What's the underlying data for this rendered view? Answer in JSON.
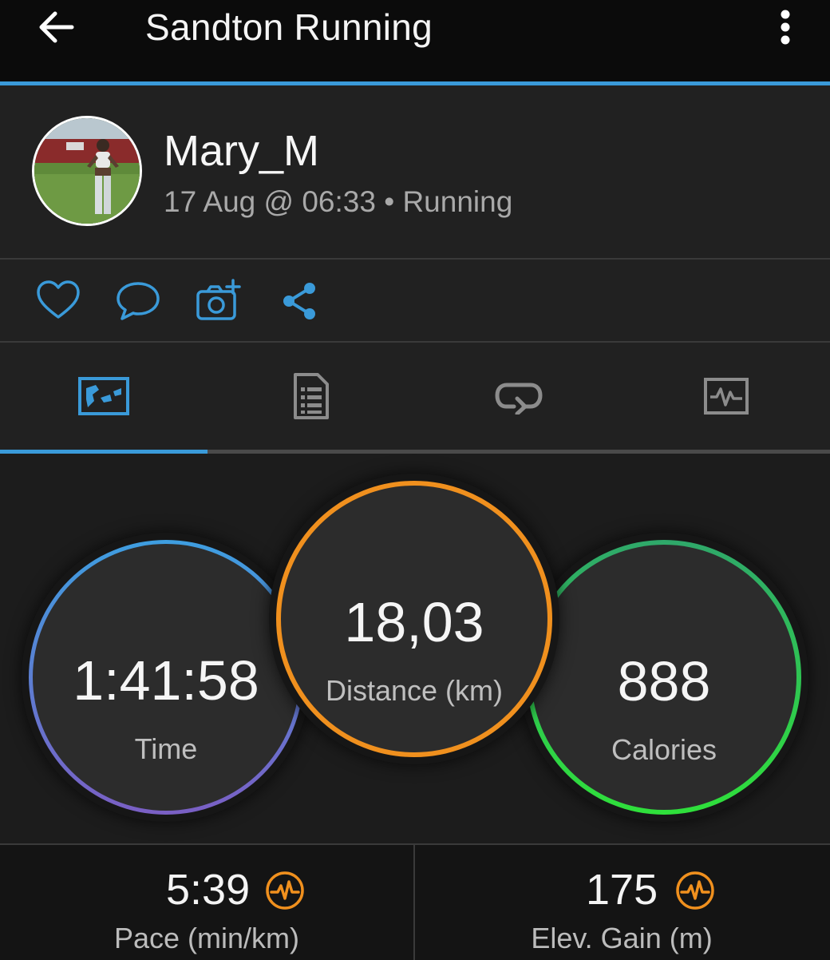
{
  "header": {
    "title": "Sandton Running",
    "back_icon": "arrow-left-icon",
    "menu_icon": "more-vertical-icon"
  },
  "profile": {
    "username": "Mary_M",
    "meta": "17 Aug @ 06:33 • Running"
  },
  "actions": [
    {
      "icon": "heart-icon"
    },
    {
      "icon": "comment-icon"
    },
    {
      "icon": "add-photo-icon"
    },
    {
      "icon": "share-icon"
    }
  ],
  "tabs": [
    {
      "icon": "map-icon",
      "active": true
    },
    {
      "icon": "stats-list-icon",
      "active": false
    },
    {
      "icon": "laps-icon",
      "active": false
    },
    {
      "icon": "charts-icon",
      "active": false
    }
  ],
  "summary": {
    "time": {
      "value": "1:41:58",
      "label": "Time"
    },
    "distance": {
      "value": "18,03",
      "label": "Distance (km)"
    },
    "calories": {
      "value": "888",
      "label": "Calories"
    }
  },
  "details": {
    "pace": {
      "value": "5:39",
      "label": "Pace (min/km)",
      "icon": "heart-rate-badge-icon"
    },
    "elevation": {
      "value": "175",
      "label": "Elev. Gain (m)",
      "icon": "heart-rate-badge-icon"
    }
  },
  "colors": {
    "accent": "#3a9ad9",
    "distance_ring": "#f0901e",
    "calories_ring": "#2fe03b",
    "time_ring_top": "#3e9ee0",
    "time_ring_bottom": "#7a5fc4",
    "badge": "#f0901e"
  }
}
